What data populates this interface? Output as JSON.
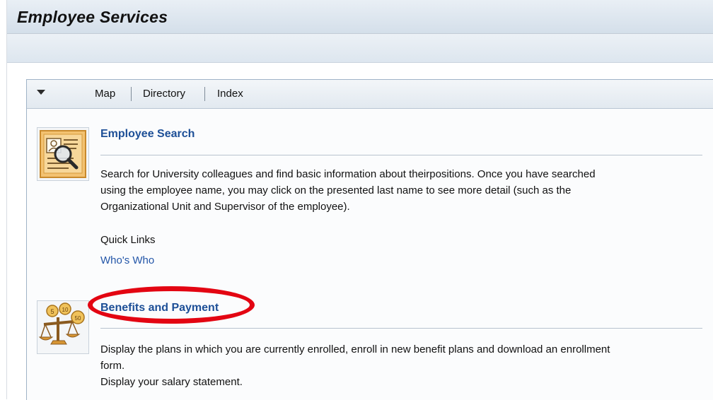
{
  "header": {
    "title": "Employee Services"
  },
  "panel": {
    "nav": [
      {
        "label": "Map"
      },
      {
        "label": "Directory"
      },
      {
        "label": "Index"
      }
    ],
    "toggle_icon": "triangle-down-icon"
  },
  "sections": [
    {
      "icon": "employee-search-icon",
      "title": "Employee Search",
      "description": [
        "Search for University colleagues and find basic information about theirpositions. Once you have searched",
        "using the employee name, you may click on the presented last name to see more detail (such as the",
        "Organizational Unit and Supervisor of the employee)."
      ],
      "quick_links_label": "Quick Links",
      "quick_links": [
        "Who's Who"
      ]
    },
    {
      "icon": "benefits-scale-icon",
      "title": "Benefits and Payment",
      "description": [
        "Display the plans in which you are currently enrolled, enroll in new benefit plans and download an enrollment",
        "form.",
        "Display your salary statement."
      ],
      "coin_labels": [
        "5",
        "10",
        "50"
      ]
    }
  ],
  "colors": {
    "link": "#1d4f97",
    "highlight": "#e30512"
  }
}
